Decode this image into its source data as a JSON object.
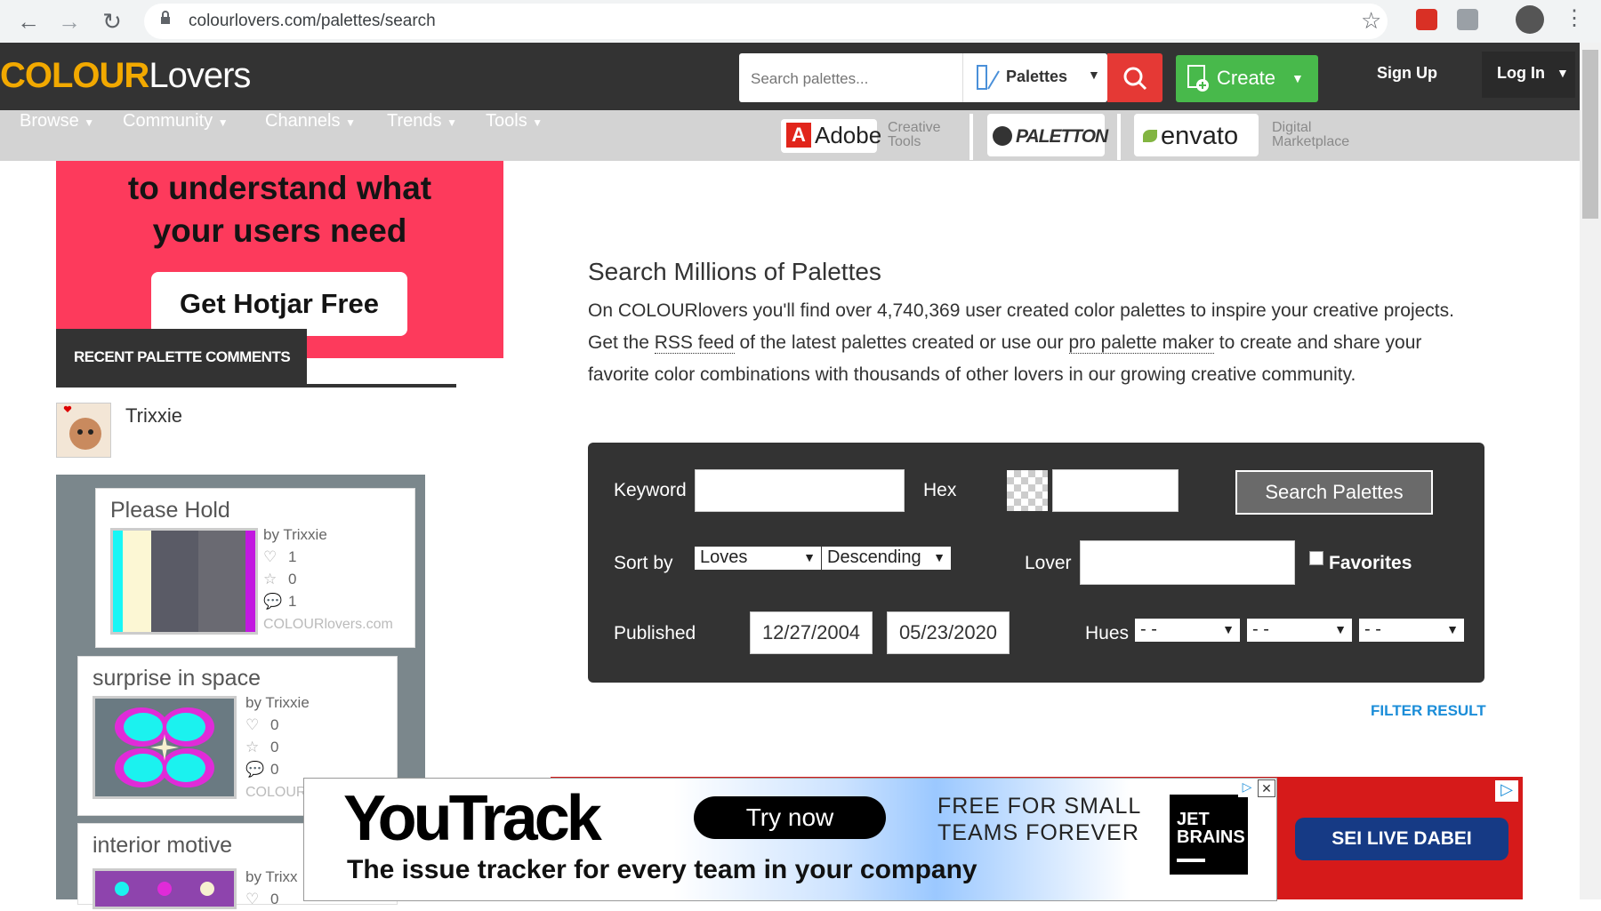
{
  "browser": {
    "url": "colourlovers.com/palettes/search"
  },
  "header": {
    "logo_colour": "COLOUR",
    "logo_lovers": "Lovers",
    "search_placeholder": "Search palettes...",
    "search_type": "Palettes",
    "create_label": "Create",
    "signup_label": "Sign Up",
    "login_label": "Log In"
  },
  "nav": {
    "items": [
      "Browse",
      "Community",
      "Channels",
      "Trends",
      "Tools"
    ]
  },
  "sponsors": {
    "adobe": "Adobe",
    "adobe_sub": [
      "Creative",
      "Tools"
    ],
    "paletton": "PALETTON",
    "envato": "envato",
    "envato_sub": [
      "Digital",
      "Marketplace"
    ]
  },
  "hotjar_ad": {
    "line1": "to understand what",
    "line2": "your users need",
    "button": "Get Hotjar Free"
  },
  "sidebar": {
    "recent_header": "RECENT PALETTE COMMENTS",
    "username": "Trixxie",
    "palettes": [
      {
        "title": "Please Hold",
        "by": "by Trixxie",
        "loves": "1",
        "favorites": "0",
        "comments": "1",
        "watermark": "COLOURlovers.com",
        "colors": [
          "#19f6f6",
          "#fcf7d4",
          "#5a5b66",
          "#6a6a72",
          "#c218e0"
        ]
      },
      {
        "title": "surprise in space",
        "by": "by Trixxie",
        "loves": "0",
        "favorites": "0",
        "comments": "0",
        "watermark": "COLOUR"
      },
      {
        "title": "interior motive",
        "by": "by Trixx",
        "loves": "0"
      }
    ]
  },
  "main": {
    "title": "Search Millions of Palettes",
    "desc_1": "On COLOURlovers you'll find over 4,740,369 user created color palettes to inspire your creative projects. Get the ",
    "rss_link": "RSS feed",
    "desc_2": " of the latest palettes created or use our ",
    "maker_link": "pro palette maker",
    "desc_3": " to create and share your favorite color combinations with thousands of other lovers in our growing creative community."
  },
  "search_form": {
    "keyword_label": "Keyword",
    "hex_label": "Hex",
    "search_button": "Search Palettes",
    "sortby_label": "Sort by",
    "sort_field": "Loves",
    "sort_order": "Descending",
    "lover_label": "Lover",
    "favorites_label": "Favorites",
    "published_label": "Published",
    "date_from": "12/27/2004",
    "date_to": "05/23/2020",
    "hues_label": "Hues",
    "hue_values": [
      "- -",
      "- -",
      "- -"
    ],
    "filter_result": "FILTER RESULT"
  },
  "youtrack_ad": {
    "logo": "YouTrack",
    "cta": "Try now",
    "free_line1": "FREE FOR SMALL",
    "free_line2": "TEAMS FOREVER",
    "jet1": "JET",
    "jet2": "BRAINS",
    "sub": "The issue tracker for every team in your company"
  },
  "red_ad": {
    "cta": "SEI LIVE DABEI"
  }
}
